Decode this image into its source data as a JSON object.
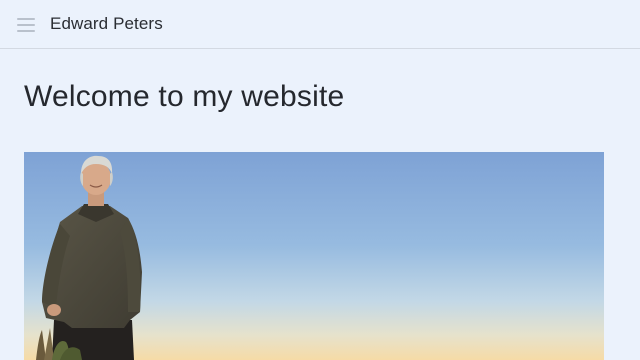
{
  "header": {
    "site_title": "Edward Peters",
    "menu_icon": "hamburger-menu-icon"
  },
  "main": {
    "heading": "Welcome to my website",
    "hero_image": {
      "subject": "photo-of-person-standing-outdoors-at-sunset",
      "sky_top_color": "#7fa3d6",
      "sky_horizon_color": "#f4dcaa"
    }
  }
}
